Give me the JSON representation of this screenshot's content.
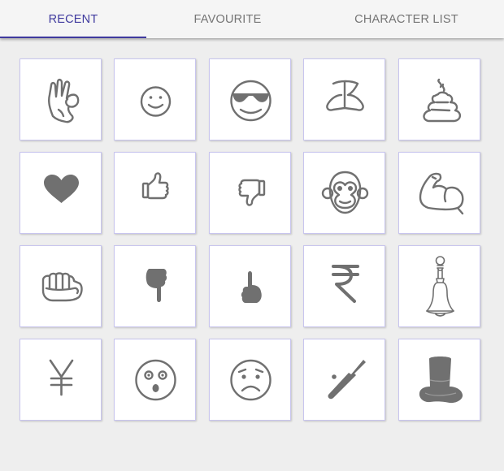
{
  "tabs": [
    {
      "label": "RECENT",
      "active": true
    },
    {
      "label": "FAVOURITE",
      "active": false
    },
    {
      "label": "CHARACTER LIST",
      "active": false
    }
  ],
  "accent_color": "#3f3a9e",
  "icon_color": "#707070",
  "grid": {
    "rows": [
      [
        "ok-hand-icon",
        "smiley-face-icon",
        "sunglasses-face-icon",
        "folded-hands-icon",
        "poop-icon"
      ],
      [
        "heart-icon",
        "thumbs-up-icon",
        "thumbs-down-icon",
        "monkey-face-icon",
        "flexed-biceps-icon"
      ],
      [
        "fist-icon",
        "pointing-down-icon",
        "pointing-up-icon",
        "rupee-sign-icon",
        "bell-icon"
      ],
      [
        "yen-sign-icon",
        "astonished-face-icon",
        "worried-face-icon",
        "cricket-bat-icon",
        "top-hat-icon"
      ]
    ]
  }
}
